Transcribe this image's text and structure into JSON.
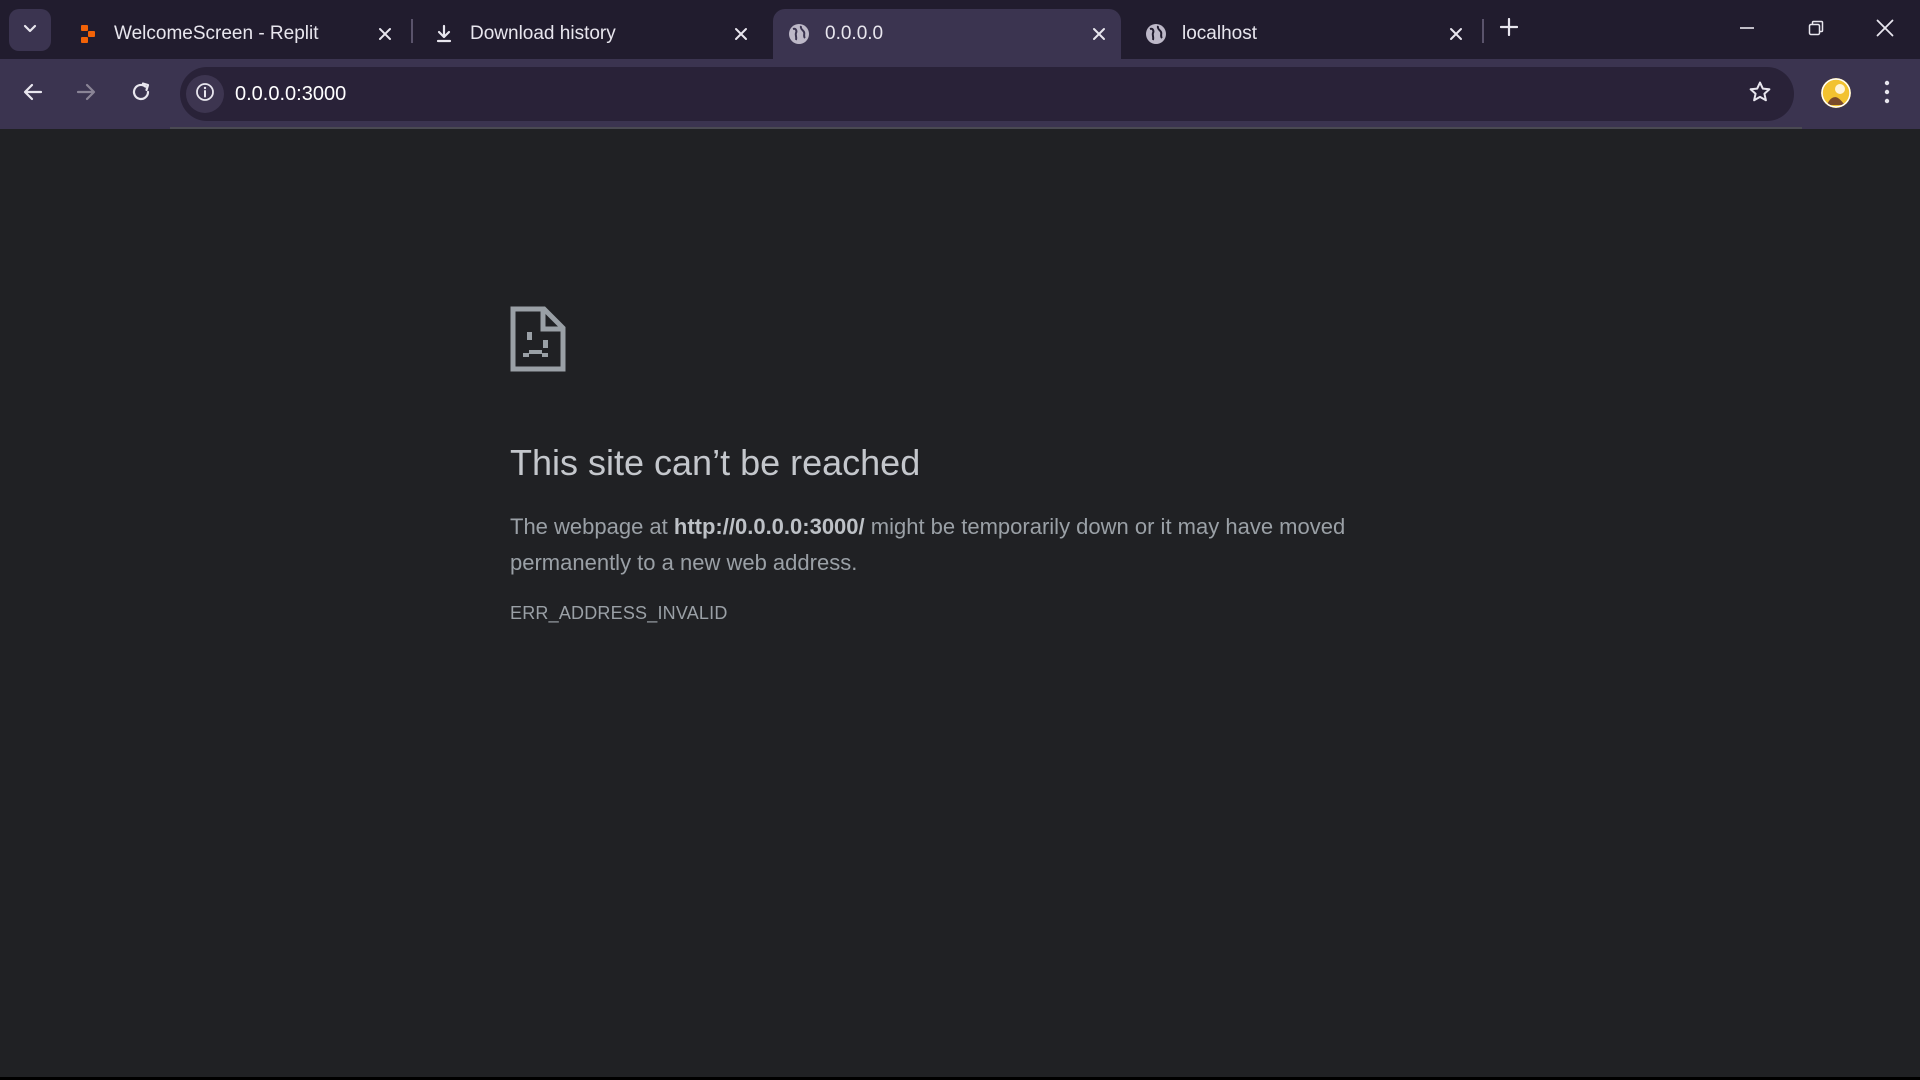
{
  "browser": {
    "tabs": [
      {
        "title": "WelcomeScreen - Replit",
        "icon": "replit-icon",
        "active": false
      },
      {
        "title": "Download history",
        "icon": "download-icon",
        "active": false
      },
      {
        "title": "0.0.0.0",
        "icon": "globe-icon",
        "active": true
      },
      {
        "title": "localhost",
        "icon": "globe-icon",
        "active": false
      }
    ],
    "address_bar": {
      "url": "0.0.0.0:3000"
    }
  },
  "error_page": {
    "title": "This site can’t be reached",
    "description_prefix": "The webpage at ",
    "description_url": "http://0.0.0.0:3000/",
    "description_suffix": " might be temporarily down or it may have moved permanently to a new web address.",
    "error_code": "ERR_ADDRESS_INVALID"
  },
  "colors": {
    "tabstrip_bg": "#211c2e",
    "toolbar_bg": "#3b3450",
    "omnibox_bg": "#292238",
    "page_bg": "#202124",
    "replit_orange": "#f26207"
  }
}
